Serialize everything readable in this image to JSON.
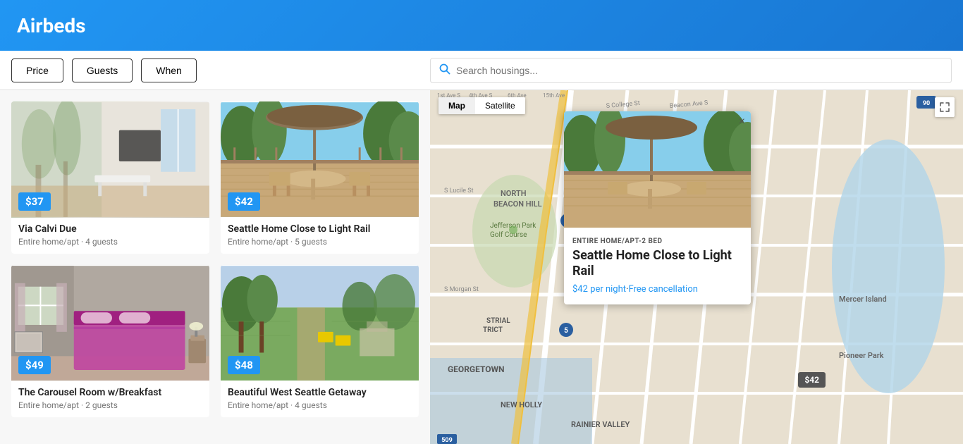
{
  "header": {
    "title": "Airbeds"
  },
  "toolbar": {
    "price_label": "Price",
    "guests_label": "Guests",
    "when_label": "When",
    "search_placeholder": "Search housings..."
  },
  "map": {
    "tab_map": "Map",
    "tab_satellite": "Satellite",
    "price_marker": "$42",
    "popup": {
      "type": "ENTIRE HOME/APT-2 BED",
      "title": "Seattle Home Close to Light Rail",
      "price_text": "$42 per night",
      "cancellation": "Free cancellation",
      "close_label": "×"
    }
  },
  "listings": [
    {
      "id": "listing-1",
      "name": "Via Calvi Due",
      "sub": "Entire home/apt · 4 guests",
      "price": "$37",
      "img_type": "living-room"
    },
    {
      "id": "listing-2",
      "name": "Seattle Home Close to Light Rail",
      "sub": "Entire home/apt · 5 guests",
      "price": "$42",
      "img_type": "deck"
    },
    {
      "id": "listing-3",
      "name": "The Carousel Room w/Breakfast",
      "sub": "Entire home/apt · 2 guests",
      "price": "$49",
      "img_type": "bedroom"
    },
    {
      "id": "listing-4",
      "name": "Beautiful West Seattle Getaway",
      "sub": "Entire home/apt · 4 guests",
      "price": "$48",
      "img_type": "yard"
    }
  ]
}
